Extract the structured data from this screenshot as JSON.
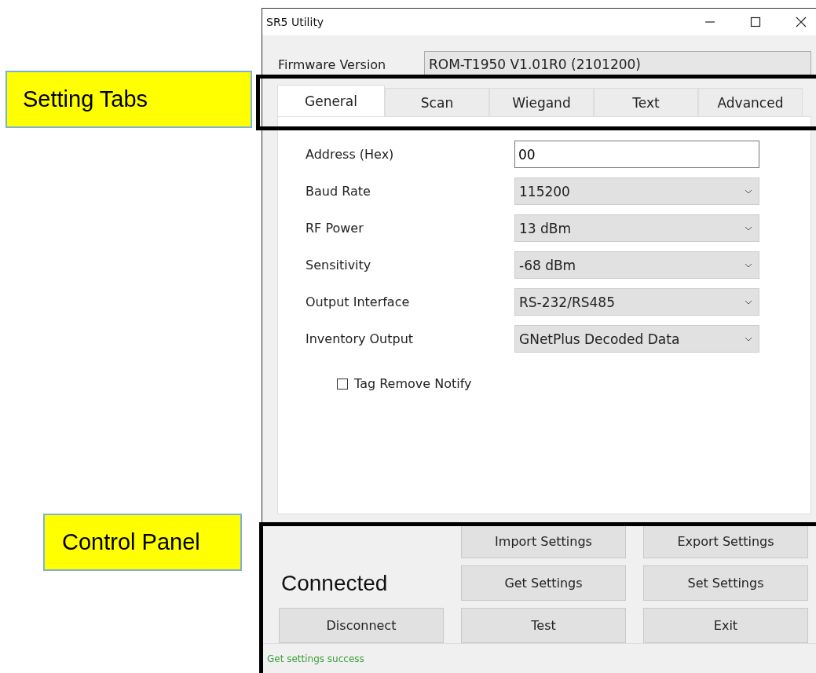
{
  "annotations": [
    {
      "text": "Setting Tabs",
      "kind": "tabs"
    },
    {
      "text": "Control Panel",
      "kind": "panel"
    }
  ],
  "window": {
    "title": "SR5 Utility"
  },
  "firmware": {
    "label": "Firmware Version",
    "value": "ROM-T1950 V1.01R0 (2101200)"
  },
  "tabs": [
    {
      "label": "General",
      "selected": true
    },
    {
      "label": "Scan",
      "selected": false
    },
    {
      "label": "Wiegand",
      "selected": false
    },
    {
      "label": "Text",
      "selected": false
    },
    {
      "label": "Advanced",
      "selected": false
    }
  ],
  "fields": [
    {
      "label": "Address (Hex)",
      "kind": "text",
      "value": "00"
    },
    {
      "label": "Baud Rate",
      "kind": "select",
      "value": "115200"
    },
    {
      "label": "RF Power",
      "kind": "select",
      "value": "13 dBm"
    },
    {
      "label": "Sensitivity",
      "kind": "select",
      "value": "-68 dBm"
    },
    {
      "label": "Output Interface",
      "kind": "select",
      "value": "RS-232/RS485"
    },
    {
      "label": "Inventory Output",
      "kind": "select",
      "value": "GNetPlus Decoded Data"
    }
  ],
  "checkbox": {
    "label": "Tag Remove Notify",
    "checked": false
  },
  "connection": "Connected",
  "buttons": [
    "Import Settings",
    "Export Settings",
    "Get Settings",
    "Set Settings",
    "Disconnect",
    "Test",
    "Exit"
  ],
  "status_bar": "Get settings success"
}
